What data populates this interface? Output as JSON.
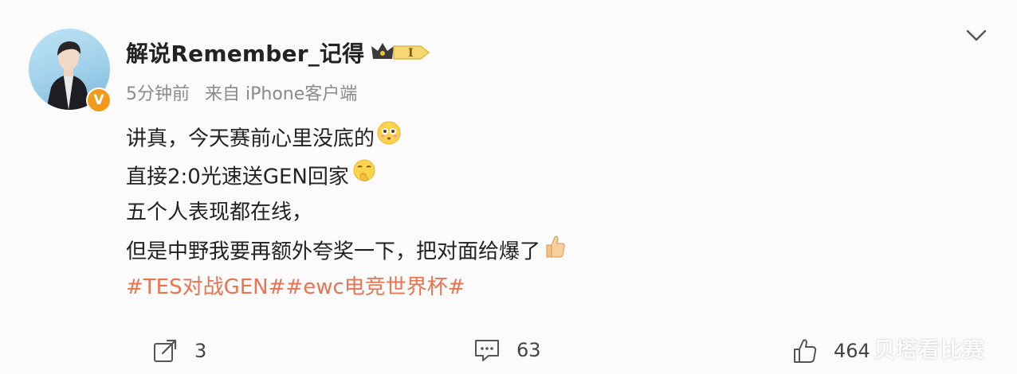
{
  "user": {
    "name": "解说Remember_记得",
    "badge_text": "I",
    "verified_mark": "V"
  },
  "meta": {
    "time": "5分钟前",
    "source": "来自 iPhone客户端"
  },
  "post": {
    "lines": [
      "讲真，今天赛前心里没底的",
      "直接2:0光速送GEN回家",
      "五个人表现都在线，",
      "但是中野我要再额外夸奖一下，把对面给爆了"
    ],
    "hashtags": "#TES对战GEN##ewc电竞世界杯#"
  },
  "actions": {
    "repost_count": "3",
    "comment_count": "63",
    "like_count": "464"
  },
  "watermark": "贝塔看比赛",
  "colors": {
    "hashtag": "#eb7350",
    "verified": "#f29a19",
    "meta": "#8a8a8a"
  },
  "icons": [
    "chevron-down-icon",
    "crown-icon",
    "repost-icon",
    "comment-icon",
    "like-icon",
    "flushed-face-emoji",
    "thinking-face-emoji",
    "thumbs-up-emoji"
  ]
}
